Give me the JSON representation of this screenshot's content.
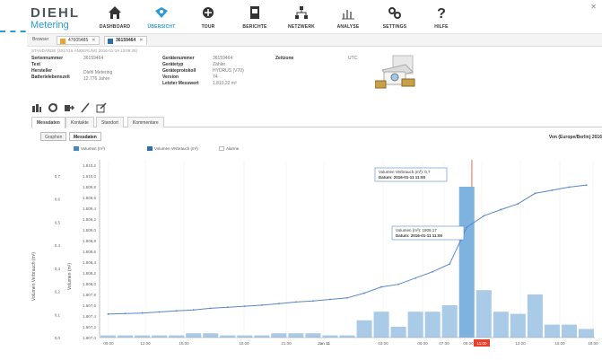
{
  "brand": {
    "line1": "DIEHL",
    "line2": "Metering"
  },
  "nav": [
    {
      "label": "DASHBOARD",
      "icon": "home-icon"
    },
    {
      "label": "ÜBERSICHT",
      "icon": "overview-icon",
      "active": true
    },
    {
      "label": "TOUR",
      "icon": "tour-icon"
    },
    {
      "label": "BERICHTE",
      "icon": "report-icon"
    },
    {
      "label": "NETZWERK",
      "icon": "network-icon"
    },
    {
      "label": "ANALYSE",
      "icon": "chart-icon"
    },
    {
      "label": "SETTINGS",
      "icon": "settings-icon"
    },
    {
      "label": "HILFE",
      "icon": "help-icon"
    }
  ],
  "tabbar": {
    "browser_label": "Browser",
    "tab1": "47605485",
    "tab2": "36159464"
  },
  "subtitle": "STANDARDE (2017/16 ÄNDERUNG 2016-01-19 13:09:28)",
  "info": {
    "seriennummer_k": "Seriennummer",
    "seriennummer_v": "36159464",
    "text_k": "Text",
    "text_v": "",
    "hersteller_k": "Hersteller",
    "hersteller_v": "Diehl Metering",
    "batterie_k": "Batterielebenszeit",
    "batterie_v": "12.776 Jahre",
    "geraet_k": "Gerätenummer",
    "geraet_v": "36159464",
    "typ_k": "Gerätetyp",
    "typ_v": "Zähler",
    "protokoll_k": "Geräteprotokoll",
    "protokoll_v": "HYDRUS (V70)",
    "version_k": "Version",
    "version_v": "74",
    "messwert_k": "Letzter Messwert",
    "messwert_v": "1.810,22 m³",
    "zeitzone_k": "Zeitzone",
    "zeitzone_v": "UTC"
  },
  "detail_tabs": [
    "Messdaten",
    "Kontakte",
    "Standort",
    "Kommentare"
  ],
  "view_toggles": [
    "Graphen",
    "Messdaten"
  ],
  "timezone_label": "Von (Europe/Berlin) 2016",
  "legend": [
    {
      "label": "Volumen (m³)",
      "color": "#4a86c4"
    },
    {
      "label": "Volumen Verbrauch (m³)",
      "color": "#2f6fb0"
    },
    {
      "label": "Alarme",
      "color": "#cccccc"
    }
  ],
  "tooltips": {
    "t1_line1": "Volumen Verbrauch (m³): 0,7",
    "t1_line2": "Datum: 2016-01-11 11:00",
    "t2_line1": "Volumen (m³): 1809,17",
    "t2_line2": "Datum: 2016-01-11 11:00"
  },
  "colors": {
    "accent": "#2a9bd4",
    "bar": "#a9cbe8",
    "bar_active": "#7fb3df",
    "line": "#5a86c8",
    "marker": "#e8412b"
  },
  "chart_data": {
    "type": "bar",
    "title": "",
    "y_left_label": "Volumen Verbrauch (m³)",
    "y_right_label": "Volumen (m³)",
    "y_left_ticks": [
      "0,7",
      "0,6",
      "0,5",
      "0,4",
      "0,3",
      "0,2",
      "0,1",
      "0,0"
    ],
    "y_left_range": [
      0,
      0.75
    ],
    "y_right_ticks": [
      "1.810,2",
      "1.810,0",
      "1.809,8",
      "1.809,6",
      "1.809,4",
      "1.809,2",
      "1.809,0",
      "1.808,8",
      "1.808,6",
      "1.808,4",
      "1.808,2",
      "1.808,0",
      "1.807,8",
      "1.807,6",
      "1.807,4",
      "1.807,2",
      "1.807,0"
    ],
    "y_right_range": [
      1807.0,
      1810.3
    ],
    "x_tick_labels": [
      "09:00",
      "12:00",
      "15:00",
      "18:00",
      "21:00",
      "Jan 11",
      "03:00",
      "06:00",
      "07:00",
      "09:00",
      "11:00",
      "12:00",
      "15:00",
      "18:00"
    ],
    "highlight_x_label": "11:00",
    "bars": [
      0.01,
      0.01,
      0.01,
      0.01,
      0.01,
      0.02,
      0.02,
      0.01,
      0.01,
      0.01,
      0.02,
      0.02,
      0.02,
      0.01,
      0.01,
      0.08,
      0.12,
      0.05,
      0.12,
      0.12,
      0.15,
      0.7,
      0.22,
      0.12,
      0.11,
      0.2,
      0.06,
      0.06,
      0.04
    ],
    "active_bar_index": 21,
    "line": [
      1807.45,
      1807.46,
      1807.47,
      1807.49,
      1807.51,
      1807.53,
      1807.56,
      1807.58,
      1807.6,
      1807.62,
      1807.65,
      1807.68,
      1807.7,
      1807.73,
      1807.76,
      1807.85,
      1807.97,
      1808.02,
      1808.14,
      1808.26,
      1808.41,
      1809.11,
      1809.33,
      1809.45,
      1809.56,
      1809.76,
      1809.82,
      1809.88,
      1809.92
    ]
  }
}
